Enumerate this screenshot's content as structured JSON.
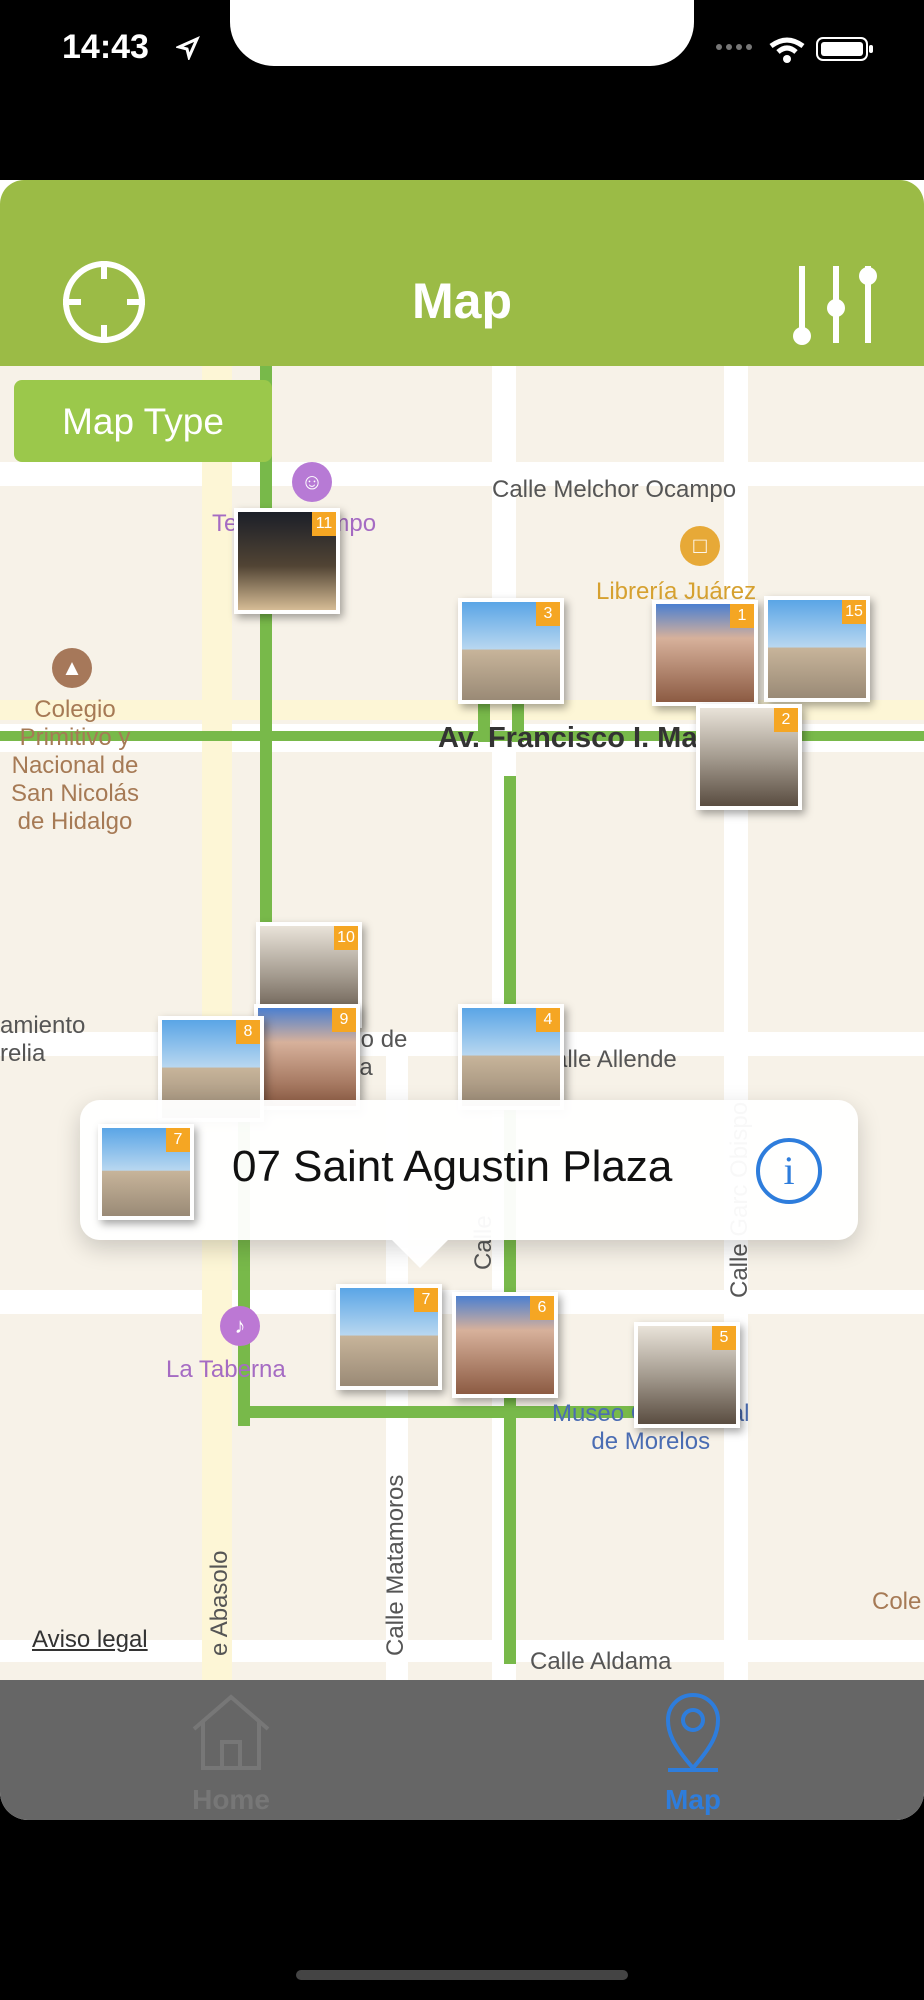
{
  "status": {
    "time": "14:43"
  },
  "nav": {
    "title": "Map"
  },
  "map": {
    "map_type_label": "Map Type",
    "labels": {
      "street_melchor": "Calle Melchor Ocampo",
      "teatro": "Teatro Ocampo",
      "libreria": "Librería Juárez",
      "colegio": "Colegio\nPrimitivo y\nNacional de\nSan Nicolás\nde Hidalgo",
      "madero": "Av. Francisco I. Madero P",
      "allende": "alle Allende",
      "palacio": "acio de\nticia",
      "ayuntamiento": "amiento\nrelia",
      "taberna": "La Taberna",
      "museo": "Museo Casa Natal\nde Morelos",
      "matamoros": "Calle Matamoros",
      "abasolo": "e Abasolo",
      "aldama": "Calle Aldama",
      "col": "Cole",
      "calle_r": "Calle Garc Obispo",
      "c_short": "Calle"
    },
    "markers": [
      "11",
      "3",
      "1",
      "15",
      "2",
      "10",
      "9",
      "8",
      "4",
      "7",
      "6",
      "5"
    ],
    "callout": {
      "title": "07 Saint Agustin Plaza",
      "number": "7"
    },
    "legal": "Aviso legal"
  },
  "tabs": [
    {
      "label": "Home"
    },
    {
      "label": "Map"
    }
  ],
  "colors": {
    "nav": "#9bbb46",
    "route": "#78b94a",
    "active_tab": "#2e7ddc"
  }
}
